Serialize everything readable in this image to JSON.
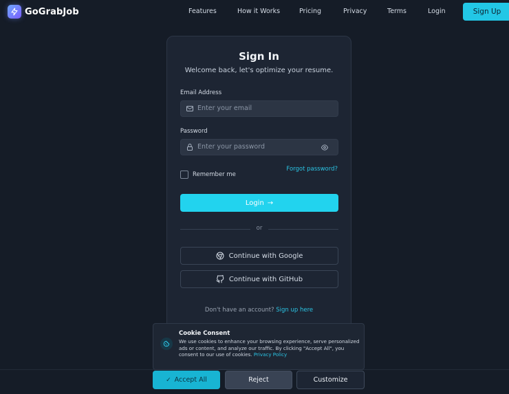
{
  "brand": {
    "name": "GoGrabJob",
    "icon": "lightning-bolt-icon"
  },
  "nav": {
    "links": [
      "Features",
      "How it Works",
      "Pricing",
      "Privacy",
      "Terms",
      "Login"
    ],
    "signup_label": "Sign Up"
  },
  "signin": {
    "title": "Sign In",
    "subtitle": "Welcome back, let's optimize your resume.",
    "email": {
      "label": "Email Address",
      "placeholder": "Enter your email",
      "icon": "mail-icon"
    },
    "password": {
      "label": "Password",
      "placeholder": "Enter your password",
      "icon": "lock-icon",
      "toggle_icon": "eye-icon"
    },
    "remember_label": "Remember me",
    "remember_checked": false,
    "forgot_label": "Forgot password?",
    "login_label": "Login",
    "divider_label": "or",
    "google_label": "Continue with Google",
    "github_label": "Continue with GitHub",
    "no_account_text": "Don't have an account?",
    "signup_link": "Sign up here"
  },
  "cookie": {
    "title": "Cookie Consent",
    "text": "We use cookies to enhance your browsing experience, serve personalized ads or content, and analyze our traffic. By clicking \"Accept All\", you consent to our use of cookies.",
    "policy_link": "Privacy Policy",
    "accept_label": "Accept All",
    "reject_label": "Reject",
    "customize_label": "Customize"
  },
  "colors": {
    "background": "#151c27",
    "card": "#1d2533",
    "accent": "#22d3ee",
    "link": "#2bc4e4"
  }
}
